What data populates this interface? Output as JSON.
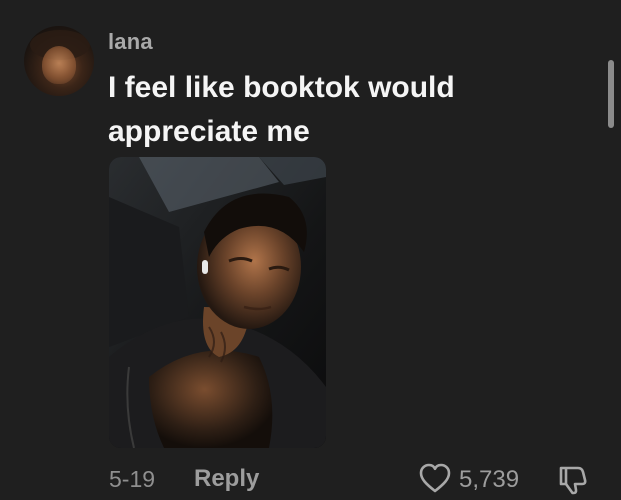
{
  "comment": {
    "username": "lana",
    "text": "I feel like booktok would appreciate me",
    "date": "5-19",
    "reply_label": "Reply",
    "like_count": "5,739"
  },
  "icons": {
    "like": "heart-icon",
    "dislike": "thumbs-down-icon"
  },
  "colors": {
    "background": "#1f1f1f",
    "username": "#a9a9a9",
    "text": "#f5f5f5",
    "secondary": "#9d9d9d"
  }
}
